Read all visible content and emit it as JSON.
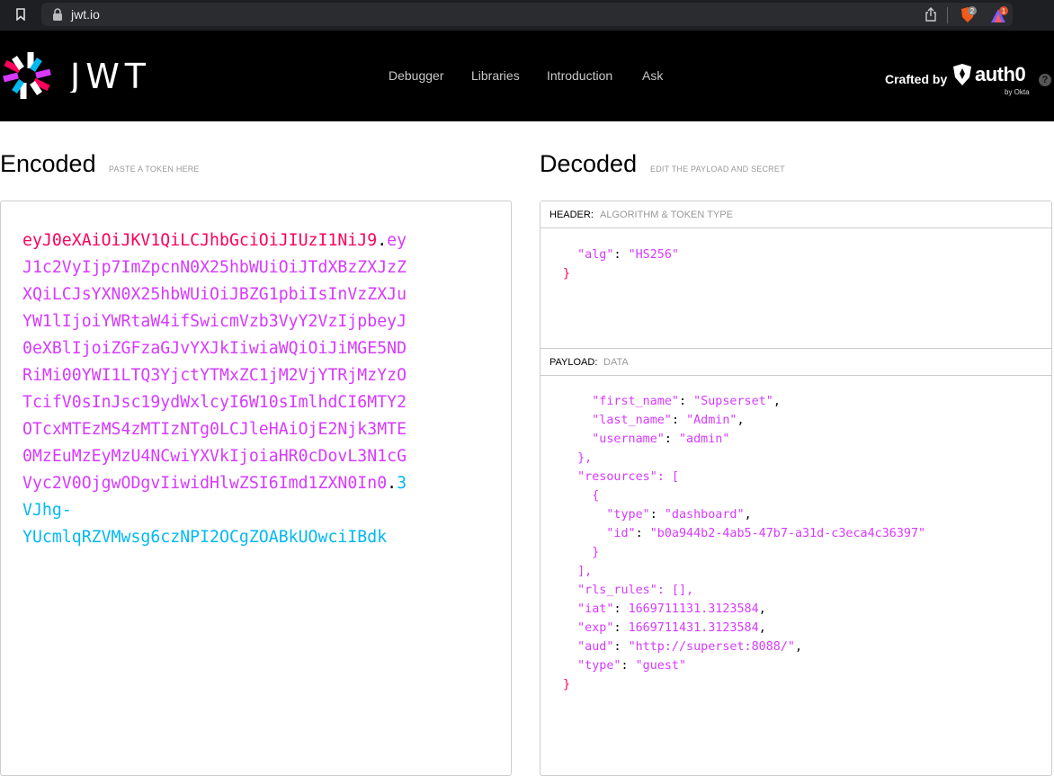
{
  "browser": {
    "url": "jwt.io",
    "ext1_badge": "2",
    "ext2_badge": "1"
  },
  "header": {
    "logo_text": "JWT",
    "nav": [
      "Debugger",
      "Libraries",
      "Introduction",
      "Ask"
    ],
    "crafted_by": "Crafted by",
    "brand": "auth0",
    "brand_sub": "by Okta",
    "help": "?"
  },
  "encoded": {
    "title": "Encoded",
    "subtitle": "PASTE A TOKEN HERE",
    "lines": [
      [
        {
          "t": "eyJ0eXAiOiJKV1QiLCJhbGciOiJIUzI1NiJ9",
          "c": "red"
        },
        {
          "t": ".",
          "c": "dot"
        },
        {
          "t": "ey",
          "c": "purple"
        }
      ],
      [
        {
          "t": "J1c2VyIjp7ImZpcnN0X25hbWUiOiJTdXBzZXJzZ",
          "c": "purple"
        }
      ],
      [
        {
          "t": "XQiLCJsYXN0X25hbWUiOiJBZG1pbiIsInVzZXJu",
          "c": "purple"
        }
      ],
      [
        {
          "t": "YW1lIjoiYWRtaW4ifSwicmVzb3VyY2VzIjpbeyJ",
          "c": "purple"
        }
      ],
      [
        {
          "t": "0eXBlIjoiZGFzaGJvYXJkIiwiaWQiOiJiMGE5ND",
          "c": "purple"
        }
      ],
      [
        {
          "t": "RiMi00YWI1LTQ3YjctYTMxZC1jM2VjYTRjMzYzO",
          "c": "purple"
        }
      ],
      [
        {
          "t": "TcifV0sInJsc19ydWxlcyI6W10sImlhdCI6MTY2",
          "c": "purple"
        }
      ],
      [
        {
          "t": "OTcxMTEzMS4zMTIzNTg0LCJleHAiOjE2Njk3MTE",
          "c": "purple"
        }
      ],
      [
        {
          "t": "0MzEuMzEyMzU4NCwiYXVkIjoiaHR0cDovL3N1cG",
          "c": "purple"
        }
      ],
      [
        {
          "t": "Vyc2V0OjgwODgvIiwidHlwZSI6Imd1ZXN0In0",
          "c": "purple"
        },
        {
          "t": ".",
          "c": "dot"
        },
        {
          "t": "3",
          "c": "blue"
        }
      ],
      [
        {
          "t": "VJhg-",
          "c": "blue"
        }
      ],
      [
        {
          "t": "YUcmlqRZVMwsg6czNPI2OCgZOABkUOwciIBdk",
          "c": "blue"
        }
      ]
    ]
  },
  "decoded": {
    "title": "Decoded",
    "subtitle": "EDIT THE PAYLOAD AND SECRET",
    "header_panel": {
      "label": "HEADER:",
      "sublabel": "ALGORITHM & TOKEN TYPE",
      "lines": [
        [
          {
            "t": "  ",
            "c": "p"
          },
          {
            "t": "\"alg\"",
            "c": "k"
          },
          {
            "t": ": ",
            "c": "p"
          },
          {
            "t": "\"HS256\"",
            "c": "s"
          }
        ],
        [
          {
            "t": "}",
            "c": "b"
          }
        ]
      ]
    },
    "payload_panel": {
      "label": "PAYLOAD:",
      "sublabel": "DATA",
      "lines": [
        [
          {
            "t": "    ",
            "c": "p"
          },
          {
            "t": "\"first_name\"",
            "c": "k"
          },
          {
            "t": ": ",
            "c": "p"
          },
          {
            "t": "\"Supserset\"",
            "c": "s"
          },
          {
            "t": ",",
            "c": "p"
          }
        ],
        [
          {
            "t": "    ",
            "c": "p"
          },
          {
            "t": "\"last_name\"",
            "c": "k"
          },
          {
            "t": ": ",
            "c": "p"
          },
          {
            "t": "\"Admin\"",
            "c": "s"
          },
          {
            "t": ",",
            "c": "p"
          }
        ],
        [
          {
            "t": "    ",
            "c": "p"
          },
          {
            "t": "\"username\"",
            "c": "k"
          },
          {
            "t": ": ",
            "c": "p"
          },
          {
            "t": "\"admin\"",
            "c": "s"
          }
        ],
        [
          {
            "t": "  },",
            "c": "k"
          }
        ],
        [
          {
            "t": "  ",
            "c": "p"
          },
          {
            "t": "\"resources\"",
            "c": "k"
          },
          {
            "t": ": [",
            "c": "k"
          }
        ],
        [
          {
            "t": "    {",
            "c": "k"
          }
        ],
        [
          {
            "t": "      ",
            "c": "p"
          },
          {
            "t": "\"type\"",
            "c": "k"
          },
          {
            "t": ": ",
            "c": "p"
          },
          {
            "t": "\"dashboard\"",
            "c": "s"
          },
          {
            "t": ",",
            "c": "p"
          }
        ],
        [
          {
            "t": "      ",
            "c": "p"
          },
          {
            "t": "\"id\"",
            "c": "k"
          },
          {
            "t": ": ",
            "c": "p"
          },
          {
            "t": "\"b0a944b2-4ab5-47b7-a31d-c3eca4c36397\"",
            "c": "s"
          }
        ],
        [
          {
            "t": "    }",
            "c": "k"
          }
        ],
        [
          {
            "t": "  ],",
            "c": "k"
          }
        ],
        [
          {
            "t": "  ",
            "c": "p"
          },
          {
            "t": "\"rls_rules\"",
            "c": "k"
          },
          {
            "t": ": [],",
            "c": "k"
          }
        ],
        [
          {
            "t": "  ",
            "c": "p"
          },
          {
            "t": "\"iat\"",
            "c": "k"
          },
          {
            "t": ": ",
            "c": "p"
          },
          {
            "t": "1669711131.3123584",
            "c": "s"
          },
          {
            "t": ",",
            "c": "p"
          }
        ],
        [
          {
            "t": "  ",
            "c": "p"
          },
          {
            "t": "\"exp\"",
            "c": "k"
          },
          {
            "t": ": ",
            "c": "p"
          },
          {
            "t": "1669711431.3123584",
            "c": "s"
          },
          {
            "t": ",",
            "c": "p"
          }
        ],
        [
          {
            "t": "  ",
            "c": "p"
          },
          {
            "t": "\"aud\"",
            "c": "k"
          },
          {
            "t": ": ",
            "c": "p"
          },
          {
            "t": "\"http://superset:8088/\"",
            "c": "s"
          },
          {
            "t": ",",
            "c": "p"
          }
        ],
        [
          {
            "t": "  ",
            "c": "p"
          },
          {
            "t": "\"type\"",
            "c": "k"
          },
          {
            "t": ": ",
            "c": "p"
          },
          {
            "t": "\"guest\"",
            "c": "s"
          }
        ],
        [
          {
            "t": "}",
            "c": "b"
          }
        ]
      ]
    }
  },
  "colors": {
    "header_red": "#fb015b",
    "payload_purple": "#d63aff",
    "signature_blue": "#00b9f1"
  }
}
